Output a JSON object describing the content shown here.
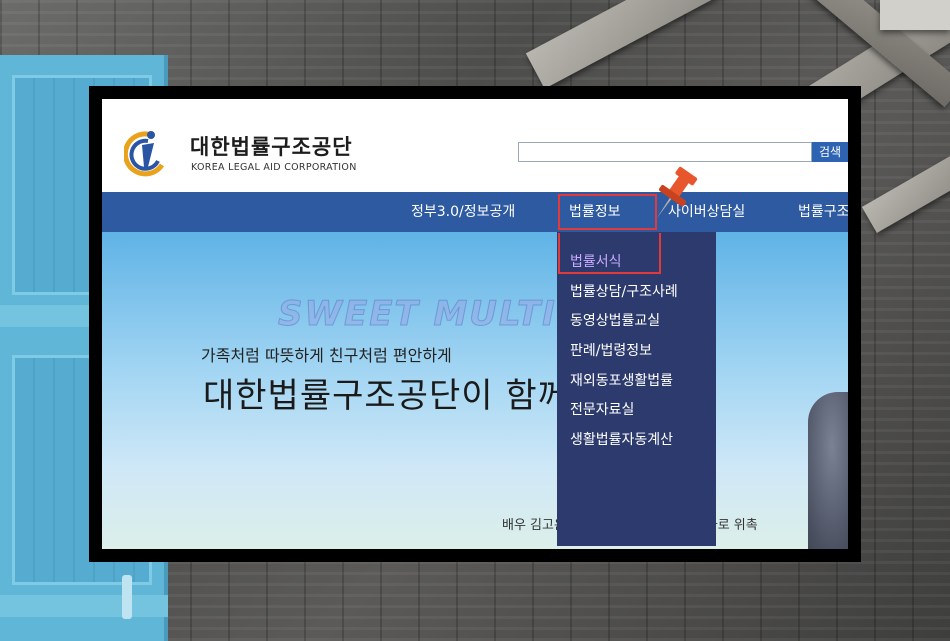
{
  "logo": {
    "korean_name": "대한법률구조공단",
    "english_name": "KOREA LEGAL AID CORPORATION"
  },
  "search": {
    "value": "",
    "button_label": "검색"
  },
  "nav": {
    "items": [
      {
        "label": "정부3.0/정보공개"
      },
      {
        "label": "법률정보"
      },
      {
        "label": "사이버상담실"
      },
      {
        "label": "법률구조"
      }
    ]
  },
  "dropdown": {
    "items": [
      {
        "label": "법률서식",
        "active": true
      },
      {
        "label": "법률상담/구조사례"
      },
      {
        "label": "동영상법률교실"
      },
      {
        "label": "판례/법령정보"
      },
      {
        "label": "재외동포생활법률"
      },
      {
        "label": "전문자료실"
      },
      {
        "label": "생활법률자동계산"
      }
    ]
  },
  "hero": {
    "subtitle": "가족처럼 따뜻하게 친구처럼 편안하게",
    "title": "대한법률구조공단이 함께합니다",
    "caption": "배우 김고은 대한법률구조공단 홍보대사로 위촉"
  },
  "watermark": "SWEET MULTI STORY",
  "colors": {
    "nav_background": "#2d5aa0",
    "dropdown_background": "#2c3a6e",
    "active_submenu_text": "#c9a8ff",
    "highlight_border": "#e23a3a",
    "search_button": "#2d63b0",
    "pin": "#e8562e"
  },
  "icons": {
    "logo": "korea-legal-aid-logo-icon",
    "pin": "push-pin-icon"
  }
}
